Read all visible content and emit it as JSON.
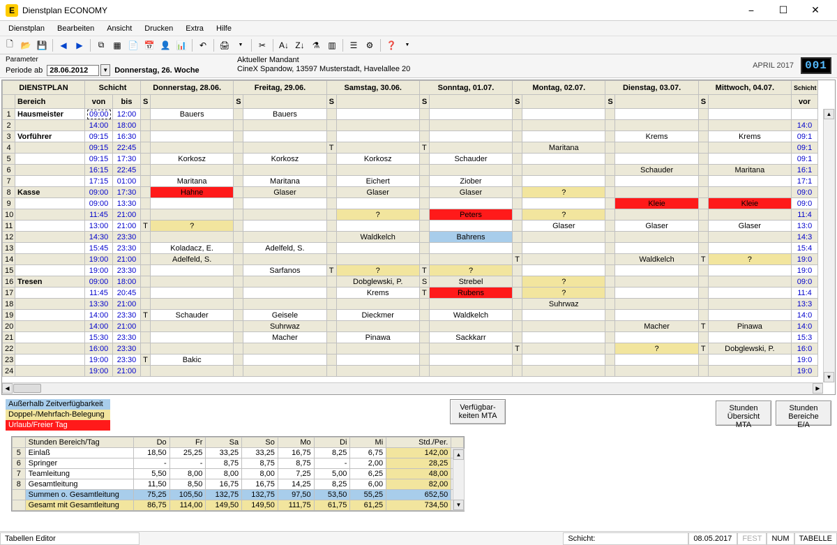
{
  "window": {
    "title": "Dienstplan ECONOMY"
  },
  "menu": [
    "Dienstplan",
    "Bearbeiten",
    "Ansicht",
    "Drucken",
    "Extra",
    "Hilfe"
  ],
  "param": {
    "label": "Parameter",
    "periode_label": "Periode ab",
    "periode_value": "28.06.2012",
    "day_label": "Donnerstag, 26. Woche",
    "mandant_label": "Aktueller Mandant",
    "mandant_value": "CineX Spandow, 13597 Musterstadt, Havelallee 20",
    "month": "APRIL 2017",
    "counter": "001"
  },
  "grid": {
    "headers": {
      "plan": "DIENSTPLAN",
      "schicht": "Schicht",
      "bereich": "Bereich",
      "von": "von",
      "bis": "bis",
      "s": "S",
      "days": [
        "Donnerstag, 28.06.",
        "Freitag, 29.06.",
        "Samstag, 30.06.",
        "Sonntag, 01.07.",
        "Montag, 02.07.",
        "Dienstag, 03.07.",
        "Mittwoch, 04.07."
      ],
      "schicht_r": "Schicht",
      "vor": "vor"
    },
    "rows": [
      {
        "n": 1,
        "bereich": "Hausmeister",
        "von": "09:00",
        "bis": "12:00",
        "cells": [
          {
            "t": "Bauers"
          },
          {
            "t": "Bauers"
          },
          {},
          {},
          {},
          {},
          {}
        ],
        "von_active": true
      },
      {
        "n": 2,
        "bereich": "",
        "von": "14:00",
        "bis": "18:00",
        "odd": true,
        "cells": [
          {},
          {},
          {},
          {},
          {},
          {},
          {}
        ],
        "vor": "14:0"
      },
      {
        "n": 3,
        "bereich": "Vorführer",
        "von": "09:15",
        "bis": "16:30",
        "cells": [
          {},
          {},
          {},
          {},
          {},
          {
            "t": "Krems"
          },
          {
            "t": "Krems"
          }
        ],
        "vor": "09:1"
      },
      {
        "n": 4,
        "bereich": "",
        "von": "09:15",
        "bis": "22:45",
        "odd": true,
        "cells": [
          {},
          {},
          {
            "s": "T"
          },
          {
            "s": "T"
          },
          {
            "t": "Maritana"
          },
          {},
          {}
        ],
        "vor": "09:1"
      },
      {
        "n": 5,
        "bereich": "",
        "von": "09:15",
        "bis": "17:30",
        "cells": [
          {
            "t": "Korkosz"
          },
          {
            "t": "Korkosz"
          },
          {
            "t": "Korkosz"
          },
          {
            "t": "Schauder"
          },
          {},
          {},
          {}
        ],
        "vor": "09:1"
      },
      {
        "n": 6,
        "bereich": "",
        "von": "16:15",
        "bis": "22:45",
        "odd": true,
        "cells": [
          {},
          {},
          {},
          {},
          {},
          {
            "t": "Schauder"
          },
          {
            "t": "Maritana"
          }
        ],
        "vor": "16:1"
      },
      {
        "n": 7,
        "bereich": "",
        "von": "17:15",
        "bis": "01:00",
        "cells": [
          {
            "t": "Maritana"
          },
          {
            "t": "Maritana"
          },
          {
            "t": "Eichert"
          },
          {
            "t": "Ziober"
          },
          {},
          {},
          {}
        ],
        "vor": "17:1"
      },
      {
        "n": 8,
        "bereich": "Kasse",
        "von": "09:00",
        "bis": "17:30",
        "odd": true,
        "cells": [
          {
            "t": "Hahne",
            "c": "red"
          },
          {
            "t": "Glaser"
          },
          {
            "t": "Glaser"
          },
          {
            "t": "Glaser"
          },
          {
            "t": "?",
            "c": "yellow"
          },
          {},
          {}
        ],
        "vor": "09:0"
      },
      {
        "n": 9,
        "bereich": "",
        "von": "09:00",
        "bis": "13:30",
        "cells": [
          {},
          {},
          {},
          {},
          {},
          {
            "t": "Kleie",
            "c": "red"
          },
          {
            "t": "Kleie",
            "c": "red"
          }
        ],
        "vor": "09:0"
      },
      {
        "n": 10,
        "bereich": "",
        "von": "11:45",
        "bis": "21:00",
        "odd": true,
        "cells": [
          {},
          {},
          {
            "t": "?",
            "c": "yellow"
          },
          {
            "t": "Peters",
            "c": "red"
          },
          {
            "t": "?",
            "c": "yellow"
          },
          {},
          {}
        ],
        "vor": "11:4"
      },
      {
        "n": 11,
        "bereich": "",
        "von": "13:00",
        "bis": "21:00",
        "cells": [
          {
            "s": "T",
            "t": "?",
            "c": "yellow"
          },
          {},
          {},
          {},
          {
            "t": "Glaser"
          },
          {
            "t": "Glaser"
          },
          {
            "t": "Glaser"
          }
        ],
        "vor": "13:0"
      },
      {
        "n": 12,
        "bereich": "",
        "von": "14:30",
        "bis": "23:30",
        "odd": true,
        "cells": [
          {},
          {},
          {
            "t": "Waldkelch"
          },
          {
            "t": "Bahrens",
            "c": "blue"
          },
          {},
          {},
          {}
        ],
        "vor": "14:3"
      },
      {
        "n": 13,
        "bereich": "",
        "von": "15:45",
        "bis": "23:30",
        "cells": [
          {
            "t": "Koladacz, E."
          },
          {
            "t": "Adelfeld, S."
          },
          {},
          {},
          {},
          {},
          {}
        ],
        "vor": "15:4"
      },
      {
        "n": 14,
        "bereich": "",
        "von": "19:00",
        "bis": "21:00",
        "odd": true,
        "cells": [
          {
            "t": "Adelfeld, S."
          },
          {},
          {},
          {},
          {
            "s": "T"
          },
          {
            "t": "Waldkelch"
          },
          {
            "s": "T",
            "t": "?",
            "c": "yellow"
          }
        ],
        "vor": "19:0"
      },
      {
        "n": 15,
        "bereich": "",
        "von": "19:00",
        "bis": "23:30",
        "cells": [
          {},
          {
            "t": "Sarfanos"
          },
          {
            "s": "T",
            "t": "?",
            "c": "yellow"
          },
          {
            "s": "T",
            "t": "?",
            "c": "yellow"
          },
          {},
          {},
          {}
        ],
        "vor": "19:0"
      },
      {
        "n": 16,
        "bereich": "Tresen",
        "von": "09:00",
        "bis": "18:00",
        "odd": true,
        "cells": [
          {},
          {},
          {
            "t": "Dobglewski, P."
          },
          {
            "s": "S",
            "t": "Strebel"
          },
          {
            "t": "?",
            "c": "yellow"
          },
          {},
          {}
        ],
        "vor": "09:0"
      },
      {
        "n": 17,
        "bereich": "",
        "von": "11:45",
        "bis": "20:45",
        "cells": [
          {},
          {},
          {
            "t": "Krems"
          },
          {
            "s": "T",
            "t": "Rubens",
            "c": "red"
          },
          {
            "t": "?",
            "c": "yellow"
          },
          {},
          {}
        ],
        "vor": "11:4"
      },
      {
        "n": 18,
        "bereich": "",
        "von": "13:30",
        "bis": "21:00",
        "odd": true,
        "cells": [
          {},
          {},
          {},
          {},
          {
            "t": "Suhrwaz"
          },
          {},
          {}
        ],
        "vor": "13:3"
      },
      {
        "n": 19,
        "bereich": "",
        "von": "14:00",
        "bis": "23:30",
        "cells": [
          {
            "s": "T",
            "t": "Schauder"
          },
          {
            "t": "Geisele"
          },
          {
            "t": "Dieckmer"
          },
          {
            "t": "Waldkelch"
          },
          {},
          {},
          {}
        ],
        "vor": "14:0"
      },
      {
        "n": 20,
        "bereich": "",
        "von": "14:00",
        "bis": "21:00",
        "odd": true,
        "cells": [
          {},
          {
            "t": "Suhrwaz"
          },
          {},
          {},
          {},
          {
            "t": "Macher"
          },
          {
            "s": "T",
            "t": "Pinawa"
          }
        ],
        "vor": "14:0"
      },
      {
        "n": 21,
        "bereich": "",
        "von": "15:30",
        "bis": "23:30",
        "cells": [
          {},
          {
            "t": "Macher"
          },
          {
            "t": "Pinawa"
          },
          {
            "t": "Sackkarr"
          },
          {},
          {},
          {}
        ],
        "vor": "15:3"
      },
      {
        "n": 22,
        "bereich": "",
        "von": "16:00",
        "bis": "23:30",
        "odd": true,
        "cells": [
          {},
          {},
          {},
          {},
          {
            "s": "T"
          },
          {
            "t": "?",
            "c": "yellow"
          },
          {
            "s": "T",
            "t": "Dobglewski, P."
          }
        ],
        "vor": "16:0"
      },
      {
        "n": 23,
        "bereich": "",
        "von": "19:00",
        "bis": "23:30",
        "cells": [
          {
            "s": "T",
            "t": "Bakic"
          },
          {},
          {},
          {},
          {},
          {},
          {}
        ],
        "vor": "19:0"
      },
      {
        "n": 24,
        "bereich": "",
        "von": "19:00",
        "bis": "21:00",
        "odd": true,
        "cells": [
          {},
          {},
          {},
          {},
          {},
          {},
          {}
        ],
        "vor": "19:0"
      }
    ]
  },
  "legend": {
    "l1": "Außerhalb Zeitverfügbarkeit",
    "l2": "Doppel-/Mehrfach-Belegung",
    "l3": "Urlaub/Freier Tag"
  },
  "buttons": {
    "mta_verfuegbar": "Verfügbar-\nkeiten MTA",
    "stunden_mta": "Stunden\nÜbersicht MTA",
    "stunden_bereiche": "Stunden\nBereiche E/A"
  },
  "summary": {
    "header": [
      "Stunden Bereich/Tag",
      "Do",
      "Fr",
      "Sa",
      "So",
      "Mo",
      "Di",
      "Mi",
      "Std./Per."
    ],
    "rows": [
      {
        "n": 5,
        "label": "Einlaß",
        "v": [
          "18,50",
          "25,25",
          "33,25",
          "33,25",
          "16,75",
          "8,25",
          "6,75"
        ],
        "per": "142,00"
      },
      {
        "n": 6,
        "label": "Springer",
        "v": [
          "-",
          "-",
          "8,75",
          "8,75",
          "8,75",
          "-",
          "2,00"
        ],
        "per": "28,25"
      },
      {
        "n": 7,
        "label": "Teamleitung",
        "v": [
          "5,50",
          "8,00",
          "8,00",
          "8,00",
          "7,25",
          "5,00",
          "6,25"
        ],
        "per": "48,00"
      },
      {
        "n": 8,
        "label": "Gesamtleitung",
        "v": [
          "11,50",
          "8,50",
          "16,75",
          "16,75",
          "14,25",
          "8,25",
          "6,00"
        ],
        "per": "82,00"
      },
      {
        "n": "",
        "label": "Summen o. Gesamtleitung",
        "v": [
          "75,25",
          "105,50",
          "132,75",
          "132,75",
          "97,50",
          "53,50",
          "55,25"
        ],
        "per": "652,50",
        "sel": true
      },
      {
        "n": "",
        "label": "Gesamt mit Gesamtleitung",
        "v": [
          "86,75",
          "114,00",
          "149,50",
          "149,50",
          "111,75",
          "61,75",
          "61,25"
        ],
        "per": "734,50",
        "sum": true
      }
    ]
  },
  "status": {
    "left": "Tabellen Editor",
    "schicht_label": "Schicht:",
    "date": "08.05.2017",
    "fest": "FEST",
    "num": "NUM",
    "tabelle": "TABELLE"
  }
}
